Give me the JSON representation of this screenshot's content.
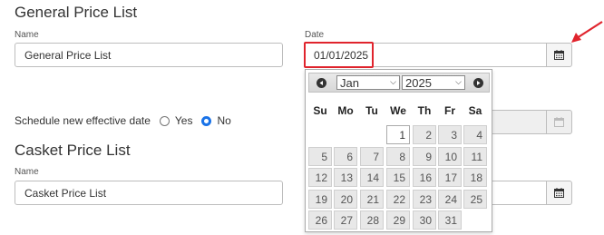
{
  "general": {
    "title": "General Price List",
    "name_label": "Name",
    "name_value": "General Price List",
    "date_label": "Date",
    "date_value": "01/01/2025"
  },
  "schedule": {
    "label": "Schedule new effective date",
    "options": [
      "Yes",
      "No"
    ],
    "selected": "No"
  },
  "casket": {
    "title": "Casket Price List",
    "name_label": "Name",
    "name_value": "Casket Price List"
  },
  "datepicker": {
    "month": "Jan",
    "year": "2025",
    "weekdays": [
      "Su",
      "Mo",
      "Tu",
      "We",
      "Th",
      "Fr",
      "Sa"
    ],
    "days": [
      "1",
      "2",
      "3",
      "4",
      "5",
      "6",
      "7",
      "8",
      "9",
      "10",
      "11",
      "12",
      "13",
      "14",
      "15",
      "16",
      "17",
      "18",
      "19",
      "20",
      "21",
      "22",
      "23",
      "24",
      "25",
      "26",
      "27",
      "28",
      "29",
      "30",
      "31"
    ],
    "first_weekday_index": 3,
    "selected_day": "1"
  },
  "annotation": {
    "arrow_color": "#e0242d"
  },
  "colors": {
    "accent": "#1a73e8",
    "highlight": "#e0242d"
  }
}
